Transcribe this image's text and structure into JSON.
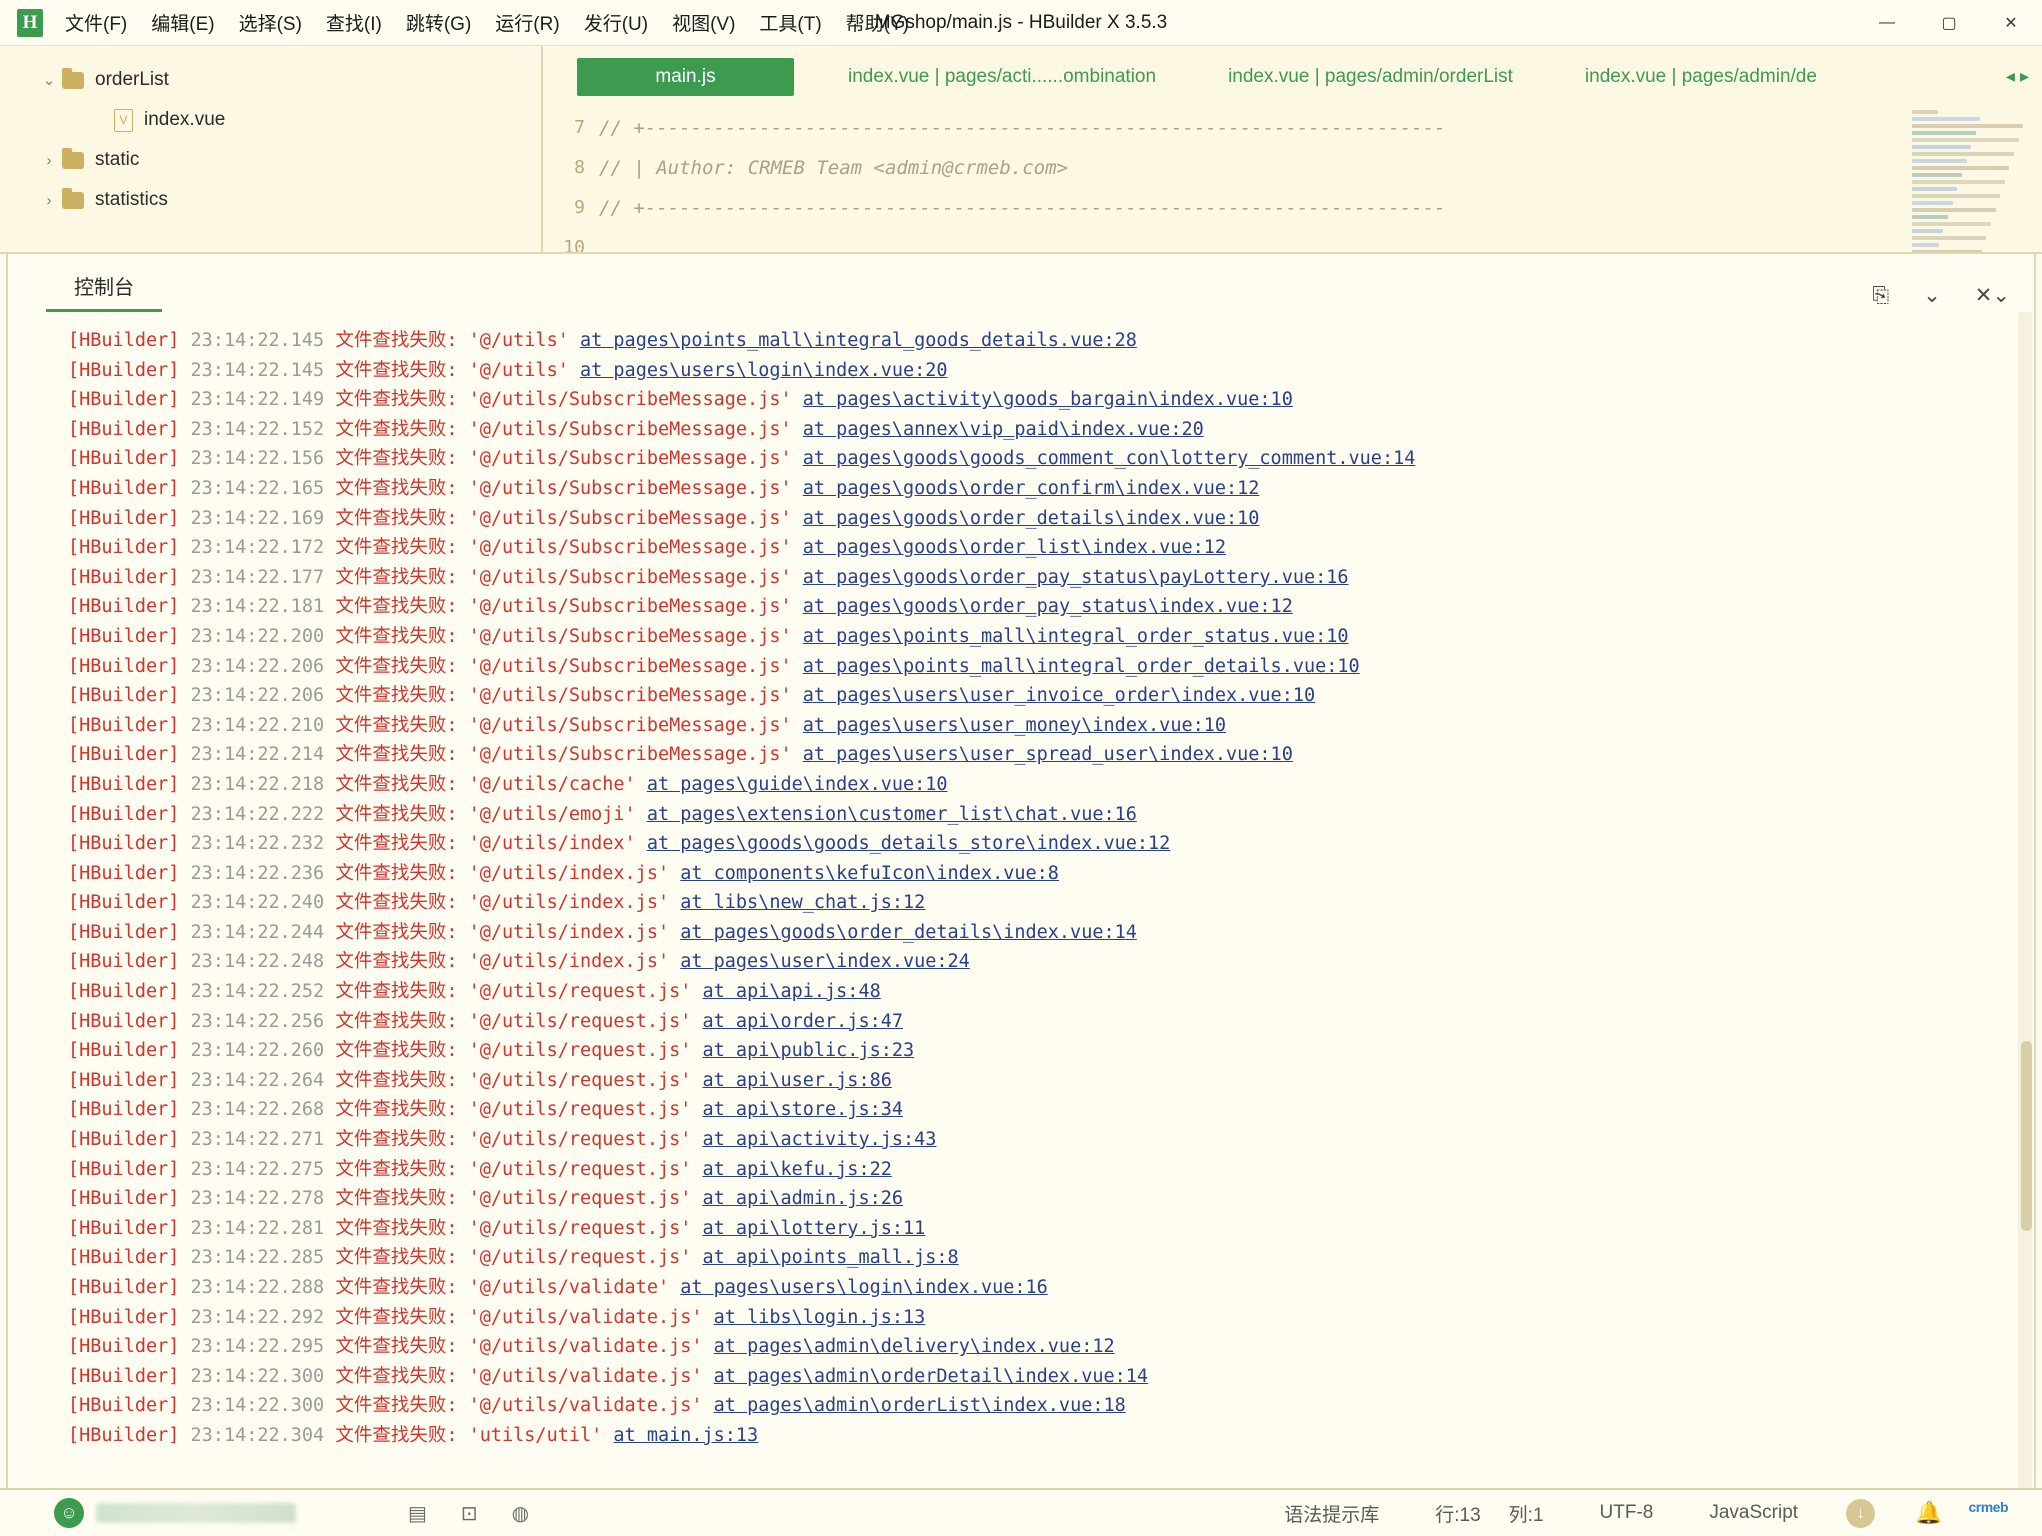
{
  "window": {
    "title": "MGshop/main.js - HBuilder X 3.5.3",
    "logo_letter": "H",
    "minimize": "—",
    "maximize": "▢",
    "close": "✕"
  },
  "menu": {
    "items": [
      {
        "label": "文件(F)",
        "name": "menu-file"
      },
      {
        "label": "编辑(E)",
        "name": "menu-edit"
      },
      {
        "label": "选择(S)",
        "name": "menu-select"
      },
      {
        "label": "查找(I)",
        "name": "menu-find"
      },
      {
        "label": "跳转(G)",
        "name": "menu-goto"
      },
      {
        "label": "运行(R)",
        "name": "menu-run"
      },
      {
        "label": "发行(U)",
        "name": "menu-publish"
      },
      {
        "label": "视图(V)",
        "name": "menu-view"
      },
      {
        "label": "工具(T)",
        "name": "menu-tools"
      },
      {
        "label": "帮助(Y)",
        "name": "menu-help"
      }
    ]
  },
  "sidebar": {
    "tree": [
      {
        "label": "orderList",
        "type": "folder",
        "twisty": "⌄",
        "indent": 1
      },
      {
        "label": "index.vue",
        "type": "vue",
        "twisty": "",
        "indent": 2
      },
      {
        "label": "static",
        "type": "folder",
        "twisty": "›",
        "indent": 1
      },
      {
        "label": "statistics",
        "type": "folder",
        "twisty": "›",
        "indent": 1
      }
    ]
  },
  "editor": {
    "tabs": [
      {
        "label": "main.js",
        "active": true
      },
      {
        "label": "index.vue | pages/acti......ombination",
        "active": false
      },
      {
        "label": "index.vue | pages/admin/orderList",
        "active": false
      },
      {
        "label": "index.vue | pages/admin/de",
        "active": false
      }
    ],
    "tab_prev": "◂",
    "tab_next": "▸",
    "lines": [
      {
        "num": "7",
        "text": "// +----------------------------------------------------------------------"
      },
      {
        "num": "8",
        "text": "// | Author: CRMEB Team <admin@crmeb.com>"
      },
      {
        "num": "9",
        "text": "// +----------------------------------------------------------------------"
      },
      {
        "num": "10",
        "text": ""
      }
    ]
  },
  "console": {
    "tab_label": "控制台",
    "tools": [
      {
        "icon": "⎘",
        "name": "open-in-new-window-icon"
      },
      {
        "icon": "⌄",
        "name": "collapse-icon"
      },
      {
        "icon": "✕⌄",
        "name": "clear-console-icon"
      }
    ],
    "log_tag": "[HBuilder]",
    "log_message": "文件查找失败:",
    "lines": [
      {
        "time": "23:14:22.145",
        "module": "'@/utils'",
        "at": "at pages\\points_mall\\integral_goods_details.vue:28"
      },
      {
        "time": "23:14:22.145",
        "module": "'@/utils'",
        "at": "at pages\\users\\login\\index.vue:20"
      },
      {
        "time": "23:14:22.149",
        "module": "'@/utils/SubscribeMessage.js'",
        "at": "at pages\\activity\\goods_bargain\\index.vue:10"
      },
      {
        "time": "23:14:22.152",
        "module": "'@/utils/SubscribeMessage.js'",
        "at": "at pages\\annex\\vip_paid\\index.vue:20"
      },
      {
        "time": "23:14:22.156",
        "module": "'@/utils/SubscribeMessage.js'",
        "at": "at pages\\goods\\goods_comment_con\\lottery_comment.vue:14"
      },
      {
        "time": "23:14:22.165",
        "module": "'@/utils/SubscribeMessage.js'",
        "at": "at pages\\goods\\order_confirm\\index.vue:12"
      },
      {
        "time": "23:14:22.169",
        "module": "'@/utils/SubscribeMessage.js'",
        "at": "at pages\\goods\\order_details\\index.vue:10"
      },
      {
        "time": "23:14:22.172",
        "module": "'@/utils/SubscribeMessage.js'",
        "at": "at pages\\goods\\order_list\\index.vue:12"
      },
      {
        "time": "23:14:22.177",
        "module": "'@/utils/SubscribeMessage.js'",
        "at": "at pages\\goods\\order_pay_status\\payLottery.vue:16"
      },
      {
        "time": "23:14:22.181",
        "module": "'@/utils/SubscribeMessage.js'",
        "at": "at pages\\goods\\order_pay_status\\index.vue:12"
      },
      {
        "time": "23:14:22.200",
        "module": "'@/utils/SubscribeMessage.js'",
        "at": "at pages\\points_mall\\integral_order_status.vue:10"
      },
      {
        "time": "23:14:22.206",
        "module": "'@/utils/SubscribeMessage.js'",
        "at": "at pages\\points_mall\\integral_order_details.vue:10"
      },
      {
        "time": "23:14:22.206",
        "module": "'@/utils/SubscribeMessage.js'",
        "at": "at pages\\users\\user_invoice_order\\index.vue:10"
      },
      {
        "time": "23:14:22.210",
        "module": "'@/utils/SubscribeMessage.js'",
        "at": "at pages\\users\\user_money\\index.vue:10"
      },
      {
        "time": "23:14:22.214",
        "module": "'@/utils/SubscribeMessage.js'",
        "at": "at pages\\users\\user_spread_user\\index.vue:10"
      },
      {
        "time": "23:14:22.218",
        "module": "'@/utils/cache'",
        "at": "at pages\\guide\\index.vue:10"
      },
      {
        "time": "23:14:22.222",
        "module": "'@/utils/emoji'",
        "at": "at pages\\extension\\customer_list\\chat.vue:16"
      },
      {
        "time": "23:14:22.232",
        "module": "'@/utils/index'",
        "at": "at pages\\goods\\goods_details_store\\index.vue:12"
      },
      {
        "time": "23:14:22.236",
        "module": "'@/utils/index.js'",
        "at": "at components\\kefuIcon\\index.vue:8"
      },
      {
        "time": "23:14:22.240",
        "module": "'@/utils/index.js'",
        "at": "at libs\\new_chat.js:12"
      },
      {
        "time": "23:14:22.244",
        "module": "'@/utils/index.js'",
        "at": "at pages\\goods\\order_details\\index.vue:14"
      },
      {
        "time": "23:14:22.248",
        "module": "'@/utils/index.js'",
        "at": "at pages\\user\\index.vue:24"
      },
      {
        "time": "23:14:22.252",
        "module": "'@/utils/request.js'",
        "at": "at api\\api.js:48"
      },
      {
        "time": "23:14:22.256",
        "module": "'@/utils/request.js'",
        "at": "at api\\order.js:47"
      },
      {
        "time": "23:14:22.260",
        "module": "'@/utils/request.js'",
        "at": "at api\\public.js:23"
      },
      {
        "time": "23:14:22.264",
        "module": "'@/utils/request.js'",
        "at": "at api\\user.js:86"
      },
      {
        "time": "23:14:22.268",
        "module": "'@/utils/request.js'",
        "at": "at api\\store.js:34"
      },
      {
        "time": "23:14:22.271",
        "module": "'@/utils/request.js'",
        "at": "at api\\activity.js:43"
      },
      {
        "time": "23:14:22.275",
        "module": "'@/utils/request.js'",
        "at": "at api\\kefu.js:22"
      },
      {
        "time": "23:14:22.278",
        "module": "'@/utils/request.js'",
        "at": "at api\\admin.js:26"
      },
      {
        "time": "23:14:22.281",
        "module": "'@/utils/request.js'",
        "at": "at api\\lottery.js:11"
      },
      {
        "time": "23:14:22.285",
        "module": "'@/utils/request.js'",
        "at": "at api\\points_mall.js:8"
      },
      {
        "time": "23:14:22.288",
        "module": "'@/utils/validate'",
        "at": "at pages\\users\\login\\index.vue:16"
      },
      {
        "time": "23:14:22.292",
        "module": "'@/utils/validate.js'",
        "at": "at libs\\login.js:13"
      },
      {
        "time": "23:14:22.295",
        "module": "'@/utils/validate.js'",
        "at": "at pages\\admin\\delivery\\index.vue:12"
      },
      {
        "time": "23:14:22.300",
        "module": "'@/utils/validate.js'",
        "at": "at pages\\admin\\orderDetail\\index.vue:14"
      },
      {
        "time": "23:14:22.300",
        "module": "'@/utils/validate.js'",
        "at": "at pages\\admin\\orderList\\index.vue:18"
      },
      {
        "time": "23:14:22.304",
        "module": "'utils/util'",
        "at": "at main.js:13"
      }
    ]
  },
  "statusbar": {
    "avatar_glyph": "☺",
    "icons": [
      {
        "glyph": "▤",
        "name": "outline-icon"
      },
      {
        "glyph": "⊡",
        "name": "terminal-icon"
      },
      {
        "glyph": "◍",
        "name": "plugin-icon"
      }
    ],
    "syntax_lib": "语法提示库",
    "line": "行:13",
    "column": "列:1",
    "encoding": "UTF-8",
    "language": "JavaScript",
    "download_glyph": "↓",
    "bell_glyph": "🔔",
    "brand": "crmeb"
  },
  "colors": {
    "accent_green": "#3d9b4f",
    "error_red": "#d0342c",
    "link_blue": "#27408b",
    "bg": "#fdf8e4",
    "panel_bg": "#fffdf2",
    "border": "#e0d7b2"
  }
}
